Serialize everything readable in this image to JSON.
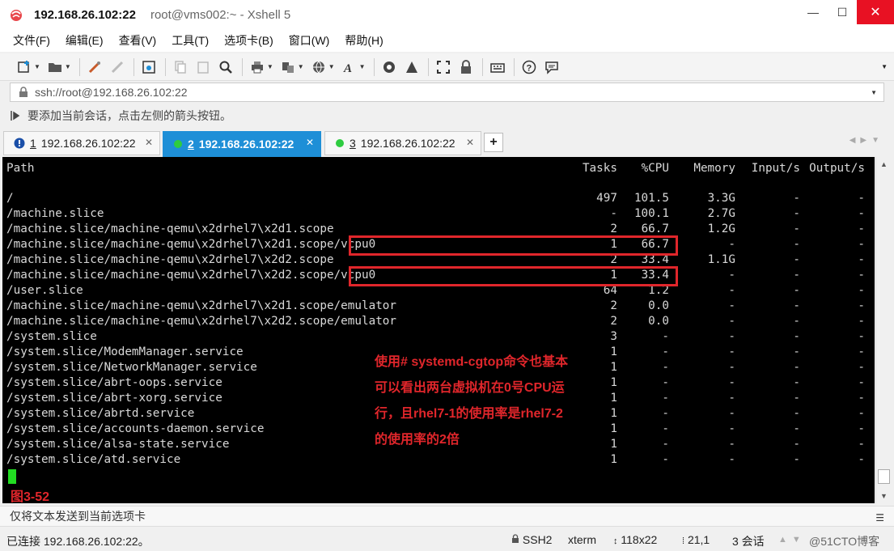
{
  "titlebar": {
    "host": "192.168.26.102:22",
    "subtitle": "root@vms002:~ - Xshell 5",
    "minimize": "—",
    "maximize": "☐",
    "close": "✕"
  },
  "menu": [
    "文件(F)",
    "编辑(E)",
    "查看(V)",
    "工具(T)",
    "选项卡(B)",
    "窗口(W)",
    "帮助(H)"
  ],
  "address": "ssh://root@192.168.26.102:22",
  "hint": "要添加当前会话，点击左侧的箭头按钮。",
  "tabs": [
    {
      "num": "1",
      "label": "192.168.26.102:22",
      "status": "alert"
    },
    {
      "num": "2",
      "label": "192.168.26.102:22",
      "status": "connected"
    },
    {
      "num": "3",
      "label": "192.168.26.102:22",
      "status": "connected"
    }
  ],
  "tab_add": "+",
  "terminal": {
    "headers": {
      "path": "Path",
      "tasks": "Tasks",
      "cpu": "%CPU",
      "memory": "Memory",
      "input": "Input/s",
      "output": "Output/s"
    },
    "rows": [
      {
        "path": "/",
        "tasks": "497",
        "cpu": "101.5",
        "memory": "3.3G",
        "input": "-",
        "output": "-"
      },
      {
        "path": "/machine.slice",
        "tasks": "-",
        "cpu": "100.1",
        "memory": "2.7G",
        "input": "-",
        "output": "-"
      },
      {
        "path": "/machine.slice/machine-qemu\\x2drhel7\\x2d1.scope",
        "tasks": "2",
        "cpu": "66.7",
        "memory": "1.2G",
        "input": "-",
        "output": "-"
      },
      {
        "path": "/machine.slice/machine-qemu\\x2drhel7\\x2d1.scope/vcpu0",
        "tasks": "1",
        "cpu": "66.7",
        "memory": "-",
        "input": "-",
        "output": "-"
      },
      {
        "path": "/machine.slice/machine-qemu\\x2drhel7\\x2d2.scope",
        "tasks": "2",
        "cpu": "33.4",
        "memory": "1.1G",
        "input": "-",
        "output": "-"
      },
      {
        "path": "/machine.slice/machine-qemu\\x2drhel7\\x2d2.scope/vcpu0",
        "tasks": "1",
        "cpu": "33.4",
        "memory": "-",
        "input": "-",
        "output": "-"
      },
      {
        "path": "/user.slice",
        "tasks": "64",
        "cpu": "1.2",
        "memory": "-",
        "input": "-",
        "output": "-"
      },
      {
        "path": "/machine.slice/machine-qemu\\x2drhel7\\x2d1.scope/emulator",
        "tasks": "2",
        "cpu": "0.0",
        "memory": "-",
        "input": "-",
        "output": "-"
      },
      {
        "path": "/machine.slice/machine-qemu\\x2drhel7\\x2d2.scope/emulator",
        "tasks": "2",
        "cpu": "0.0",
        "memory": "-",
        "input": "-",
        "output": "-"
      },
      {
        "path": "/system.slice",
        "tasks": "3",
        "cpu": "-",
        "memory": "-",
        "input": "-",
        "output": "-"
      },
      {
        "path": "/system.slice/ModemManager.service",
        "tasks": "1",
        "cpu": "-",
        "memory": "-",
        "input": "-",
        "output": "-"
      },
      {
        "path": "/system.slice/NetworkManager.service",
        "tasks": "1",
        "cpu": "-",
        "memory": "-",
        "input": "-",
        "output": "-"
      },
      {
        "path": "/system.slice/abrt-oops.service",
        "tasks": "1",
        "cpu": "-",
        "memory": "-",
        "input": "-",
        "output": "-"
      },
      {
        "path": "/system.slice/abrt-xorg.service",
        "tasks": "1",
        "cpu": "-",
        "memory": "-",
        "input": "-",
        "output": "-"
      },
      {
        "path": "/system.slice/abrtd.service",
        "tasks": "1",
        "cpu": "-",
        "memory": "-",
        "input": "-",
        "output": "-"
      },
      {
        "path": "/system.slice/accounts-daemon.service",
        "tasks": "1",
        "cpu": "-",
        "memory": "-",
        "input": "-",
        "output": "-"
      },
      {
        "path": "/system.slice/alsa-state.service",
        "tasks": "1",
        "cpu": "-",
        "memory": "-",
        "input": "-",
        "output": "-"
      },
      {
        "path": "/system.slice/atd.service",
        "tasks": "1",
        "cpu": "-",
        "memory": "-",
        "input": "-",
        "output": "-"
      }
    ],
    "annotation": [
      "使用# systemd-cgtop命令也基本",
      "可以看出两台虚拟机在0号CPU运",
      "行，且rhel7-1的使用率是rhel7-2",
      "的使用率的2倍"
    ],
    "figure_label": "图3-52"
  },
  "sendbar": "仅将文本发送到当前选项卡",
  "status": {
    "connection": "已连接 192.168.26.102:22。",
    "protocol": "SSH2",
    "terminal_type": "xterm",
    "size": "118x22",
    "cursor_pos": "21,1",
    "sessions": "3 会话",
    "watermark": "@51CTO博客"
  },
  "colors": {
    "accent": "#1e8fd7",
    "highlight": "#e0262b",
    "cursor": "#22dd22",
    "terminal_bg": "#000000"
  }
}
